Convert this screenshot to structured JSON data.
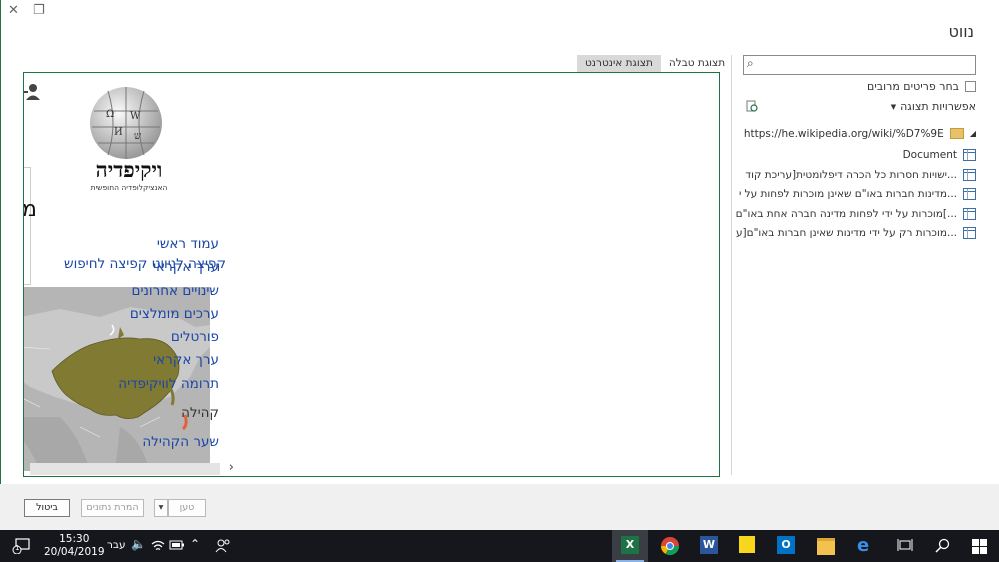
{
  "window": {
    "title": "נווט",
    "close_glyph": "✕",
    "restore_glyph": "❐"
  },
  "navigator": {
    "search_placeholder": "",
    "select_multiple_label": "בחר פריטים מרובים",
    "display_options_label": "אפשרויות תצוגה",
    "root_url": "https://he.wikipedia.org/wiki/%D7%9E%D7%9...",
    "items": [
      {
        "label": "Document"
      },
      {
        "label": "ישויות חסרות כל הכרה דיפלומטית[עריכת קוד..."
      },
      {
        "label": "מדינות חברות באו\"ם שאינן מוכרות לפחות על י..."
      },
      {
        "label": "מוכרות על ידי לפחות מדינה חברה אחת באו\"ם[..."
      },
      {
        "label": "מוכרות רק על ידי מדינות שאינן חברות באו\"ם[ע..."
      }
    ]
  },
  "preview": {
    "tabs": [
      {
        "label": "תצוגת טבלה"
      },
      {
        "label": "תצוגת אינטרנט"
      }
    ],
    "wiki": {
      "logo_text": "ויקיפדיה",
      "tagline": "האנציקלופדיה החופשית",
      "nav_links": [
        "עמוד ראשי",
        "ערך אקראי",
        "שינויים אחרונים",
        "ערכים מומלצים",
        "פורטלים",
        "ערך אקראי",
        "תרומה לוויקיפדיה"
      ],
      "overlay_text": "קפיצה לניווט קפיצה לחיפוש",
      "community_heading": "קהילה",
      "community_link": "שער הקהילה"
    }
  },
  "footer": {
    "load_label": "טען",
    "transform_label": "המרת נתונים",
    "cancel_label": "ביטול"
  },
  "taskbar": {
    "time": "15:30",
    "date": "20/04/2019",
    "language": "עבר",
    "notification_count": "1"
  },
  "colors": {
    "excel_green": "#1f7244",
    "link_blue": "#1a46a8",
    "map_olive": "#807a32",
    "taskbar": "#15171d"
  }
}
